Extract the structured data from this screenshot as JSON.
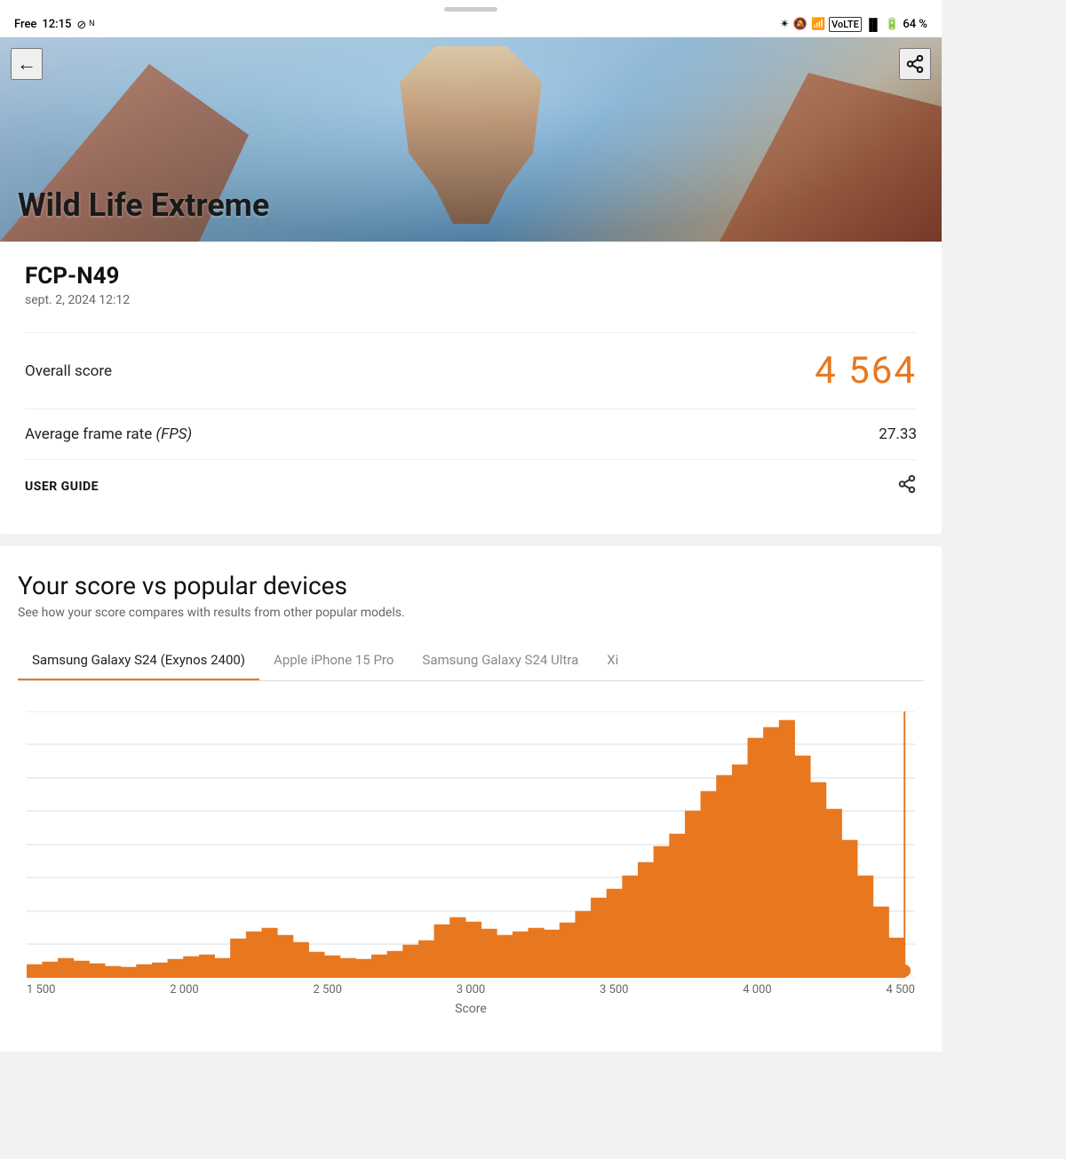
{
  "statusBar": {
    "left": {
      "carrier": "Free",
      "time": "12:15"
    },
    "right": {
      "battery": "64 %"
    }
  },
  "hero": {
    "title": "Wild Life Extreme",
    "backLabel": "←",
    "shareLabel": "share"
  },
  "card": {
    "deviceName": "FCP-N49",
    "testDate": "sept. 2, 2024 12:12",
    "overallScoreLabel": "Overall score",
    "overallScoreValue": "4 564",
    "fpsLabel": "Average frame rate",
    "fpsUnit": "(FPS)",
    "fpsValue": "27.33",
    "userGuideLabel": "USER GUIDE"
  },
  "comparison": {
    "title": "Your score vs popular devices",
    "subtitle": "See how your score compares with results from other popular models.",
    "tabs": [
      {
        "id": "samsung-s24",
        "label": "Samsung Galaxy S24 (Exynos 2400)",
        "active": true
      },
      {
        "id": "iphone-15-pro",
        "label": "Apple iPhone 15 Pro",
        "active": false
      },
      {
        "id": "samsung-s24-ultra",
        "label": "Samsung Galaxy S24 Ultra",
        "active": false
      },
      {
        "id": "xi",
        "label": "Xi",
        "active": false
      }
    ],
    "xAxisLabel": "Score",
    "xAxisTicks": [
      "1 500",
      "2 000",
      "2 500",
      "3 000",
      "3 500",
      "4 000",
      "4 500"
    ],
    "currentScoreLine": 4564,
    "accentColor": "#e87820"
  }
}
